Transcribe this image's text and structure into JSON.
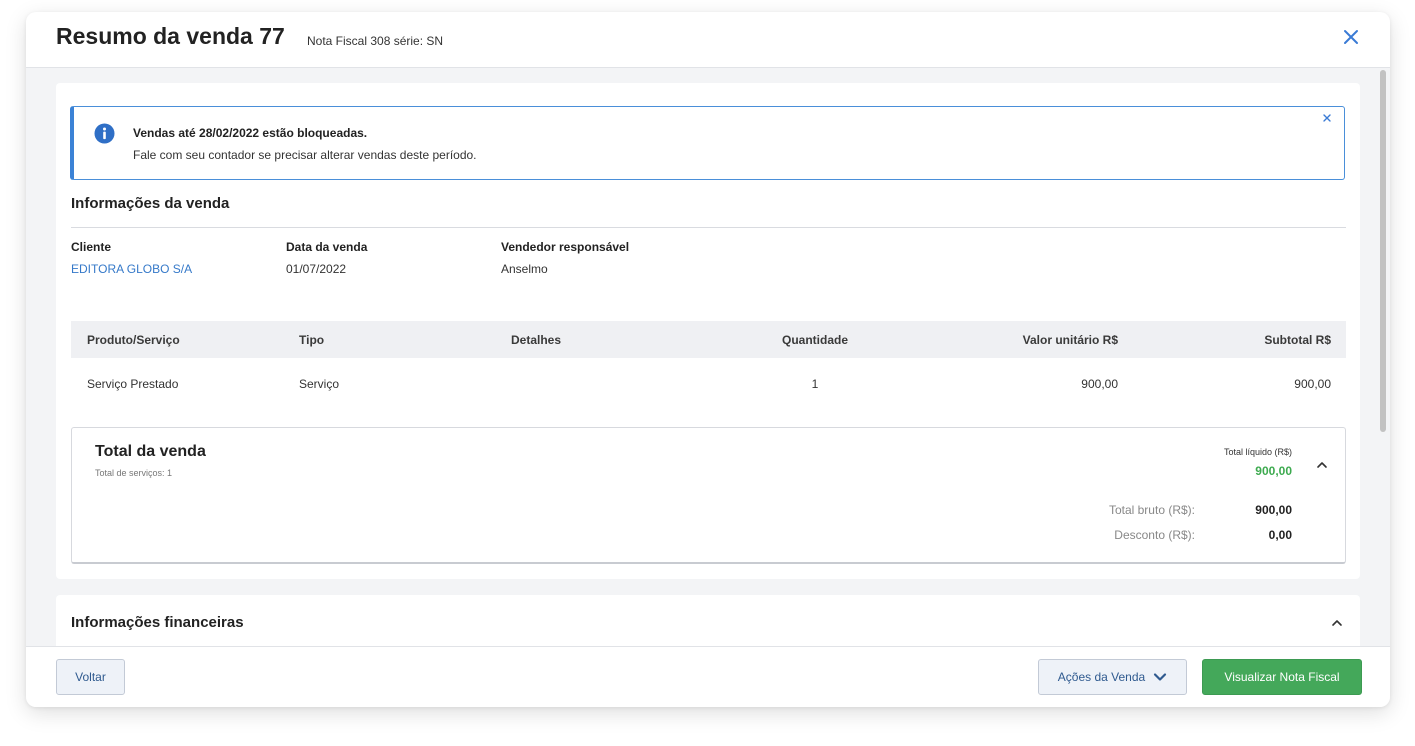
{
  "header": {
    "title": "Resumo da venda 77",
    "subtitle": "Nota Fiscal 308 série: SN"
  },
  "alert": {
    "title": "Vendas até 28/02/2022 estão bloqueadas.",
    "text": "Fale com seu contador se precisar alterar vendas deste período."
  },
  "sale_info": {
    "section_title": "Informações da venda",
    "client_label": "Cliente",
    "client_value": "EDITORA GLOBO S/A",
    "date_label": "Data da venda",
    "date_value": "01/07/2022",
    "seller_label": "Vendedor responsável",
    "seller_value": "Anselmo"
  },
  "table": {
    "headers": [
      "Produto/Serviço",
      "Tipo",
      "Detalhes",
      "Quantidade",
      "Valor unitário R$",
      "Subtotal R$"
    ],
    "rows": [
      [
        "Serviço Prestado",
        "Serviço",
        "",
        "1",
        "900,00",
        "900,00"
      ]
    ]
  },
  "totals": {
    "title": "Total da venda",
    "subtitle": "Total de serviços: 1",
    "net_label": "Total líquido (R$)",
    "net_value": "900,00",
    "gross_label": "Total bruto (R$):",
    "gross_value": "900,00",
    "discount_label": "Desconto (R$):",
    "discount_value": "0,00"
  },
  "financial": {
    "section_title": "Informações financeiras"
  },
  "footer": {
    "back_label": "Voltar",
    "actions_label": "Ações da Venda",
    "invoice_label": "Visualizar Nota Fiscal"
  },
  "colors": {
    "accent_blue": "#3b82d6",
    "link_blue": "#3579c9",
    "success_green": "#44a85a",
    "net_value_green": "#3daa4f"
  },
  "icons": [
    "close-icon",
    "info-icon",
    "alert-close-icon",
    "chevron-up-icon",
    "chevron-down-icon"
  ]
}
